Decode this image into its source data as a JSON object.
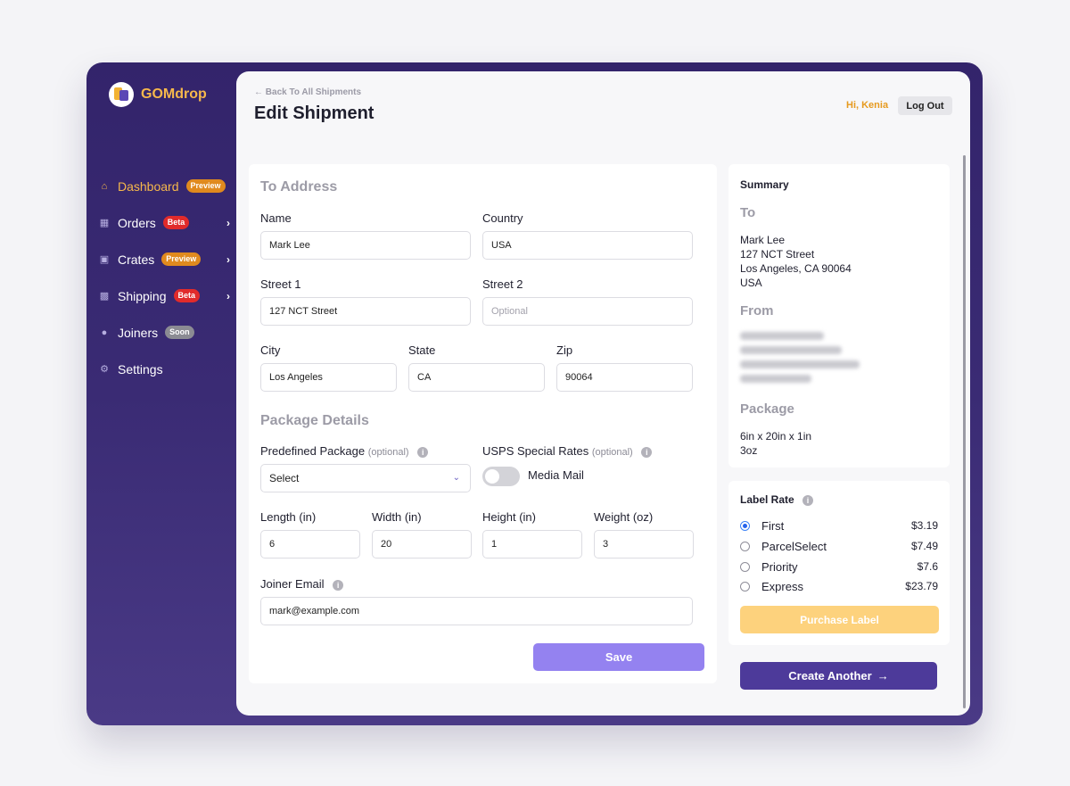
{
  "app": {
    "name": "GOMdrop"
  },
  "sidebar": {
    "items": [
      {
        "label": "Dashboard",
        "badge": "Preview",
        "icon": "home-icon",
        "active": true,
        "chevron": false
      },
      {
        "label": "Orders",
        "badge": "Beta",
        "icon": "grid-icon",
        "chevron": true
      },
      {
        "label": "Crates",
        "badge": "Preview",
        "icon": "crates-icon",
        "chevron": true
      },
      {
        "label": "Shipping",
        "badge": "Beta",
        "icon": "shipping-icon",
        "chevron": true
      },
      {
        "label": "Joiners",
        "badge": "Soon",
        "icon": "users-icon",
        "chevron": false
      },
      {
        "label": "Settings",
        "badge": "",
        "icon": "gear-icon",
        "chevron": false
      }
    ]
  },
  "header": {
    "back_link": "Back To All Shipments",
    "title": "Edit Shipment",
    "greeting": "Hi, Kenia",
    "logout": "Log Out"
  },
  "form": {
    "to_address_title": "To Address",
    "name": {
      "label": "Name",
      "value": "Mark Lee"
    },
    "country": {
      "label": "Country",
      "value": "USA"
    },
    "street1": {
      "label": "Street 1",
      "value": "127 NCT Street"
    },
    "street2": {
      "label": "Street 2",
      "placeholder": "Optional"
    },
    "city": {
      "label": "City",
      "value": "Los Angeles"
    },
    "state": {
      "label": "State",
      "value": "CA"
    },
    "zip": {
      "label": "Zip",
      "value": "90064"
    },
    "package_title": "Package Details",
    "predefined": {
      "label": "Predefined Package",
      "optional": "(optional)",
      "value": "Select"
    },
    "usps": {
      "label": "USPS Special Rates",
      "optional": "(optional)",
      "toggle_label": "Media Mail",
      "toggle_on": false
    },
    "length": {
      "label": "Length (in)",
      "value": "6"
    },
    "width": {
      "label": "Width (in)",
      "value": "20"
    },
    "height": {
      "label": "Height (in)",
      "value": "1"
    },
    "weight": {
      "label": "Weight (oz)",
      "value": "3"
    },
    "joiner_email": {
      "label": "Joiner Email",
      "value": "mark@example.com"
    },
    "save": "Save"
  },
  "summary": {
    "title": "Summary",
    "to_heading": "To",
    "to_lines": [
      "Mark Lee",
      "127 NCT Street",
      "Los Angeles, CA 90064",
      "USA"
    ],
    "from_heading": "From",
    "package_heading": "Package",
    "package_lines": [
      "6in x 20in x 1in",
      "3oz"
    ]
  },
  "label_rate": {
    "title": "Label Rate",
    "options": [
      {
        "name": "First",
        "price": "$3.19",
        "selected": true
      },
      {
        "name": "ParcelSelect",
        "price": "$7.49",
        "selected": false
      },
      {
        "name": "Priority",
        "price": "$7.6",
        "selected": false
      },
      {
        "name": "Express",
        "price": "$23.79",
        "selected": false
      }
    ],
    "purchase": "Purchase Label"
  },
  "create_another": "Create Another",
  "colors": {
    "sidebar_top": "#33246b",
    "accent_orange": "#f7b84b",
    "save_button": "#9482f0",
    "create_button": "#4d3a9a",
    "purchase_button": "#fdd27d"
  }
}
